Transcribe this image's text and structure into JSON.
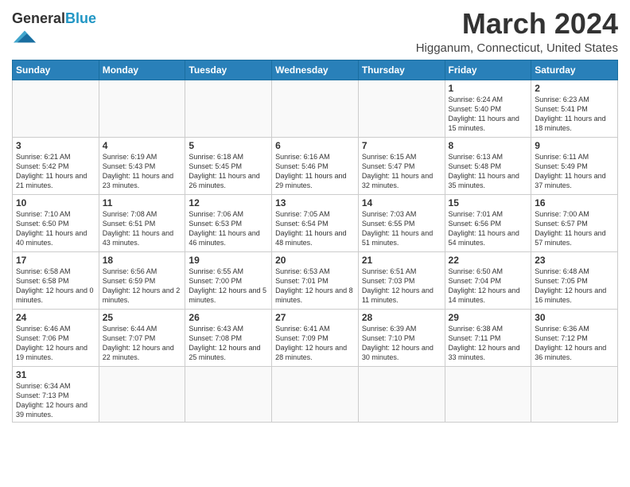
{
  "header": {
    "logo_general": "General",
    "logo_blue": "Blue",
    "month_title": "March 2024",
    "location": "Higganum, Connecticut, United States"
  },
  "weekdays": [
    "Sunday",
    "Monday",
    "Tuesday",
    "Wednesday",
    "Thursday",
    "Friday",
    "Saturday"
  ],
  "weeks": [
    [
      {
        "day": "",
        "info": ""
      },
      {
        "day": "",
        "info": ""
      },
      {
        "day": "",
        "info": ""
      },
      {
        "day": "",
        "info": ""
      },
      {
        "day": "",
        "info": ""
      },
      {
        "day": "1",
        "info": "Sunrise: 6:24 AM\nSunset: 5:40 PM\nDaylight: 11 hours and 15 minutes."
      },
      {
        "day": "2",
        "info": "Sunrise: 6:23 AM\nSunset: 5:41 PM\nDaylight: 11 hours and 18 minutes."
      }
    ],
    [
      {
        "day": "3",
        "info": "Sunrise: 6:21 AM\nSunset: 5:42 PM\nDaylight: 11 hours and 21 minutes."
      },
      {
        "day": "4",
        "info": "Sunrise: 6:19 AM\nSunset: 5:43 PM\nDaylight: 11 hours and 23 minutes."
      },
      {
        "day": "5",
        "info": "Sunrise: 6:18 AM\nSunset: 5:45 PM\nDaylight: 11 hours and 26 minutes."
      },
      {
        "day": "6",
        "info": "Sunrise: 6:16 AM\nSunset: 5:46 PM\nDaylight: 11 hours and 29 minutes."
      },
      {
        "day": "7",
        "info": "Sunrise: 6:15 AM\nSunset: 5:47 PM\nDaylight: 11 hours and 32 minutes."
      },
      {
        "day": "8",
        "info": "Sunrise: 6:13 AM\nSunset: 5:48 PM\nDaylight: 11 hours and 35 minutes."
      },
      {
        "day": "9",
        "info": "Sunrise: 6:11 AM\nSunset: 5:49 PM\nDaylight: 11 hours and 37 minutes."
      }
    ],
    [
      {
        "day": "10",
        "info": "Sunrise: 7:10 AM\nSunset: 6:50 PM\nDaylight: 11 hours and 40 minutes."
      },
      {
        "day": "11",
        "info": "Sunrise: 7:08 AM\nSunset: 6:51 PM\nDaylight: 11 hours and 43 minutes."
      },
      {
        "day": "12",
        "info": "Sunrise: 7:06 AM\nSunset: 6:53 PM\nDaylight: 11 hours and 46 minutes."
      },
      {
        "day": "13",
        "info": "Sunrise: 7:05 AM\nSunset: 6:54 PM\nDaylight: 11 hours and 48 minutes."
      },
      {
        "day": "14",
        "info": "Sunrise: 7:03 AM\nSunset: 6:55 PM\nDaylight: 11 hours and 51 minutes."
      },
      {
        "day": "15",
        "info": "Sunrise: 7:01 AM\nSunset: 6:56 PM\nDaylight: 11 hours and 54 minutes."
      },
      {
        "day": "16",
        "info": "Sunrise: 7:00 AM\nSunset: 6:57 PM\nDaylight: 11 hours and 57 minutes."
      }
    ],
    [
      {
        "day": "17",
        "info": "Sunrise: 6:58 AM\nSunset: 6:58 PM\nDaylight: 12 hours and 0 minutes."
      },
      {
        "day": "18",
        "info": "Sunrise: 6:56 AM\nSunset: 6:59 PM\nDaylight: 12 hours and 2 minutes."
      },
      {
        "day": "19",
        "info": "Sunrise: 6:55 AM\nSunset: 7:00 PM\nDaylight: 12 hours and 5 minutes."
      },
      {
        "day": "20",
        "info": "Sunrise: 6:53 AM\nSunset: 7:01 PM\nDaylight: 12 hours and 8 minutes."
      },
      {
        "day": "21",
        "info": "Sunrise: 6:51 AM\nSunset: 7:03 PM\nDaylight: 12 hours and 11 minutes."
      },
      {
        "day": "22",
        "info": "Sunrise: 6:50 AM\nSunset: 7:04 PM\nDaylight: 12 hours and 14 minutes."
      },
      {
        "day": "23",
        "info": "Sunrise: 6:48 AM\nSunset: 7:05 PM\nDaylight: 12 hours and 16 minutes."
      }
    ],
    [
      {
        "day": "24",
        "info": "Sunrise: 6:46 AM\nSunset: 7:06 PM\nDaylight: 12 hours and 19 minutes."
      },
      {
        "day": "25",
        "info": "Sunrise: 6:44 AM\nSunset: 7:07 PM\nDaylight: 12 hours and 22 minutes."
      },
      {
        "day": "26",
        "info": "Sunrise: 6:43 AM\nSunset: 7:08 PM\nDaylight: 12 hours and 25 minutes."
      },
      {
        "day": "27",
        "info": "Sunrise: 6:41 AM\nSunset: 7:09 PM\nDaylight: 12 hours and 28 minutes."
      },
      {
        "day": "28",
        "info": "Sunrise: 6:39 AM\nSunset: 7:10 PM\nDaylight: 12 hours and 30 minutes."
      },
      {
        "day": "29",
        "info": "Sunrise: 6:38 AM\nSunset: 7:11 PM\nDaylight: 12 hours and 33 minutes."
      },
      {
        "day": "30",
        "info": "Sunrise: 6:36 AM\nSunset: 7:12 PM\nDaylight: 12 hours and 36 minutes."
      }
    ],
    [
      {
        "day": "31",
        "info": "Sunrise: 6:34 AM\nSunset: 7:13 PM\nDaylight: 12 hours and 39 minutes."
      },
      {
        "day": "",
        "info": ""
      },
      {
        "day": "",
        "info": ""
      },
      {
        "day": "",
        "info": ""
      },
      {
        "day": "",
        "info": ""
      },
      {
        "day": "",
        "info": ""
      },
      {
        "day": "",
        "info": ""
      }
    ]
  ]
}
